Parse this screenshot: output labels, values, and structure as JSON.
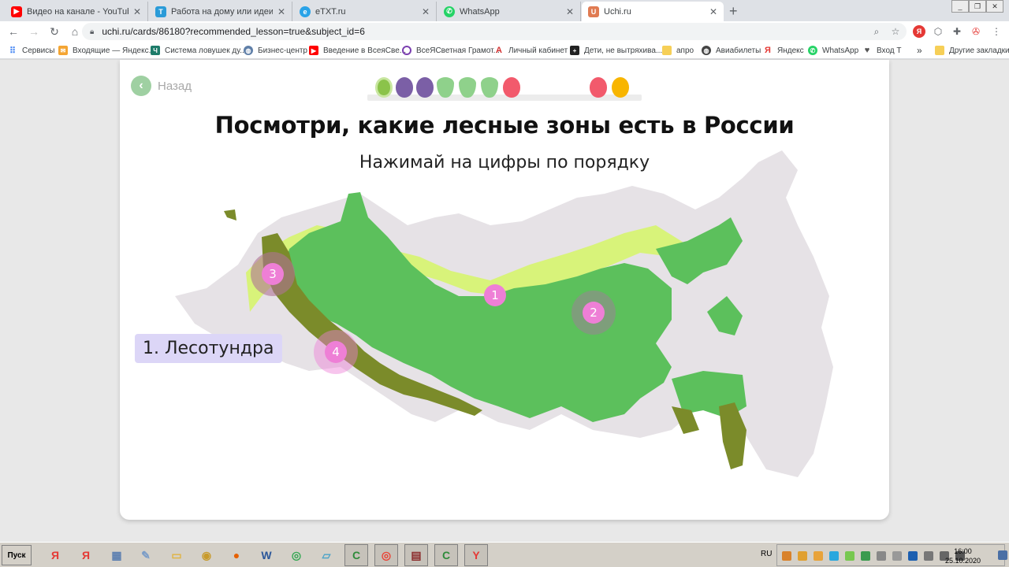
{
  "browser": {
    "tabs": [
      {
        "title": "Видео на канале - YouTube Studio",
        "favicon": "youtube-icon",
        "active": false
      },
      {
        "title": "Работа на дому или идеи дополн",
        "favicon": "text-doc-icon",
        "active": false
      },
      {
        "title": "eTXT.ru",
        "favicon": "etxt-icon",
        "active": false
      },
      {
        "title": "WhatsApp",
        "favicon": "whatsapp-icon",
        "active": false
      },
      {
        "title": "Uchi.ru",
        "favicon": "uchi-icon",
        "active": true
      }
    ],
    "new_tab": "+",
    "url": "uchi.ru/cards/86180?recommended_lesson=true&subject_id=6",
    "bookmarks": [
      {
        "label": "Сервисы",
        "icon": "apps-icon"
      },
      {
        "label": "Входящие — Яндекс...",
        "icon": "mail-icon"
      },
      {
        "label": "Система ловушек ду...",
        "icon": "ch-icon"
      },
      {
        "label": "Бизнес-центр",
        "icon": "globe-icon"
      },
      {
        "label": "Введение в ВсеяСве...",
        "icon": "youtube-icon"
      },
      {
        "label": "ВсеЯСветная Грамот...",
        "icon": "circle-icon"
      },
      {
        "label": "Личный кабинет",
        "icon": "a-icon"
      },
      {
        "label": "Дети, не вытряхива...",
        "icon": "plus-icon"
      },
      {
        "label": "апро",
        "icon": "folder-icon"
      },
      {
        "label": "Авиабилеты",
        "icon": "globe-icon"
      },
      {
        "label": "Яндекс",
        "icon": "yandex-icon"
      },
      {
        "label": "WhatsApp",
        "icon": "whatsapp-icon"
      },
      {
        "label": "Вход Т",
        "icon": "shield-icon"
      }
    ],
    "more_bookmarks": "»",
    "other_bookmarks": "Другие закладки"
  },
  "page": {
    "back_label": "Назад",
    "title": "Посмотри, какие лесные зоны есть в России",
    "subtitle": "Нажимай на цифры по порядку",
    "zone_label": "1. Лесотундра",
    "markers": [
      "1",
      "2",
      "3",
      "4"
    ],
    "progress_fruits": [
      {
        "kind": "kiwi",
        "color": "#8bc34a"
      },
      {
        "kind": "plum",
        "color": "#7b5fa6"
      },
      {
        "kind": "plum",
        "color": "#7b5fa6"
      },
      {
        "kind": "pear",
        "color": "#8fd18b"
      },
      {
        "kind": "pear",
        "color": "#8fd18b"
      },
      {
        "kind": "pear",
        "color": "#8fd18b"
      },
      {
        "kind": "apple",
        "color": "#f25a6c"
      },
      {
        "kind": "apple",
        "color": "#f25a6c"
      },
      {
        "kind": "orange",
        "color": "#f8b500"
      }
    ],
    "colors": {
      "forest": "#5cc05c",
      "forest_tundra": "#d8f37a",
      "mixed_forest": "#7b8b2a",
      "land": "#e6e2e6",
      "marker": "#ee7fd6"
    }
  },
  "taskbar": {
    "start_label": "Пуск",
    "apps": [
      "yandex-browser-icon",
      "yandex-icon",
      "calculator-icon",
      "paint-icon",
      "folder-icon",
      "chromium-icon",
      "firefox-icon",
      "word-icon",
      "chrome-icon",
      "notepad-icon",
      "camtasia-icon",
      "chrome-icon",
      "book-icon",
      "camtasia-icon",
      "yandex-icon"
    ],
    "language": "RU",
    "time": "16:00",
    "date": "25.10.2020"
  }
}
